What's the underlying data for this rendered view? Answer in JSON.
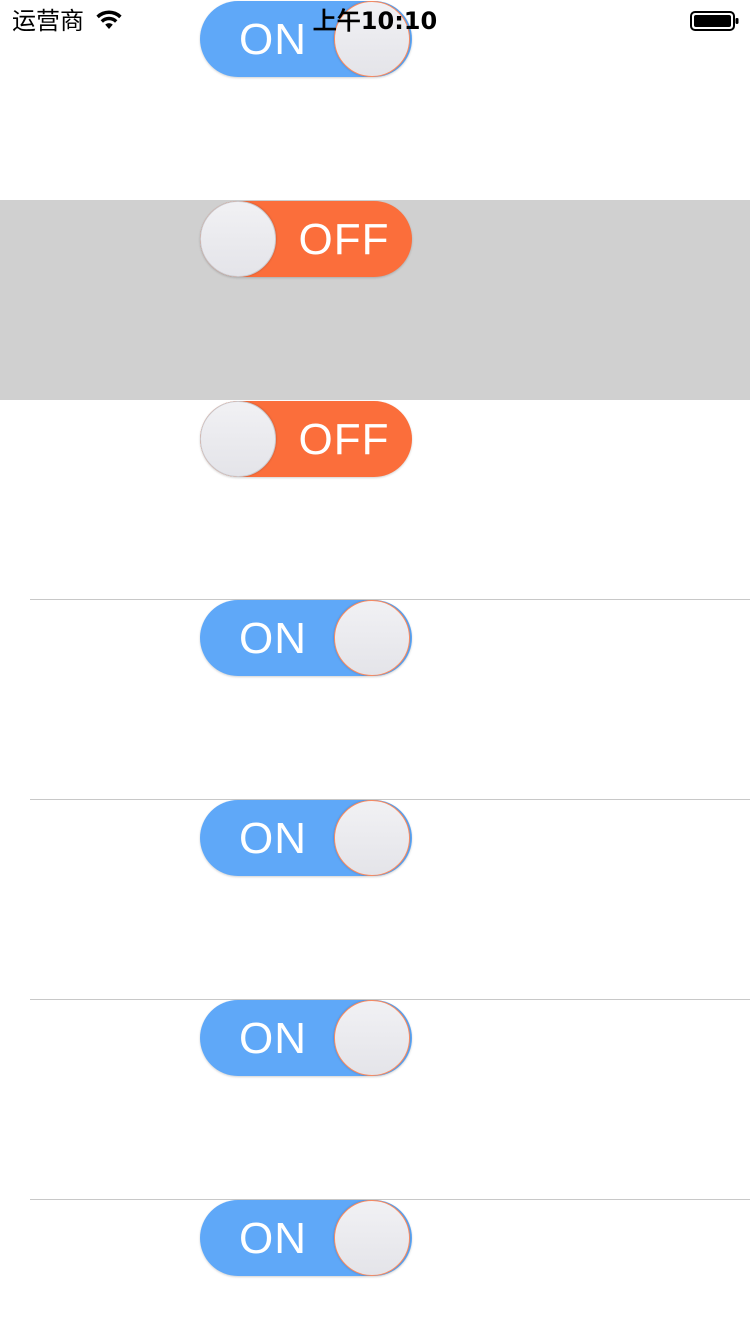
{
  "status_bar": {
    "carrier": "运营商",
    "time": "上午10:10",
    "wifi_icon": "wifi-icon",
    "battery_icon": "battery-icon"
  },
  "colors": {
    "on": "#5fa8f8",
    "off": "#fb6e3b",
    "highlight_row": "#d0d0d0",
    "separator": "#c8c8c8"
  },
  "rows": [
    {
      "label": "ON",
      "state": "on",
      "highlighted": false
    },
    {
      "label": "OFF",
      "state": "off",
      "highlighted": true
    },
    {
      "label": "OFF",
      "state": "off",
      "highlighted": false
    },
    {
      "label": "ON",
      "state": "on",
      "highlighted": false
    },
    {
      "label": "ON",
      "state": "on",
      "highlighted": false
    },
    {
      "label": "ON",
      "state": "on",
      "highlighted": false
    },
    {
      "label": "ON",
      "state": "on",
      "highlighted": false
    }
  ]
}
